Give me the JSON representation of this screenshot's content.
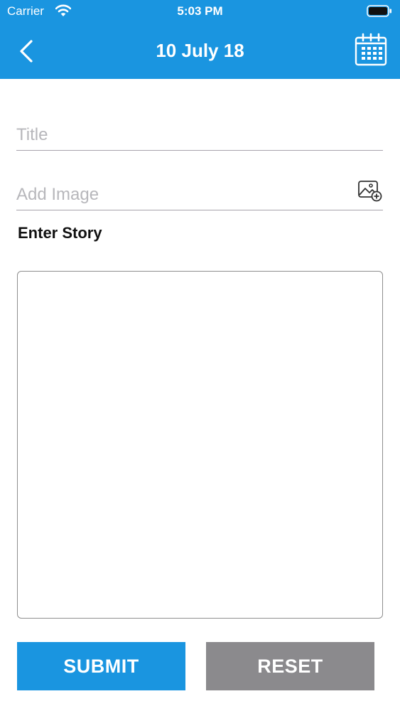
{
  "status_bar": {
    "carrier": "Carrier",
    "time": "5:03 PM"
  },
  "nav": {
    "title": "10 July 18",
    "back_icon": "chevron-left-icon",
    "calendar_icon": "calendar-icon"
  },
  "form": {
    "title_placeholder": "Title",
    "image_placeholder": "Add Image",
    "image_icon": "add-image-icon",
    "story_label": "Enter Story",
    "story_value": ""
  },
  "actions": {
    "submit_label": "SUBMIT",
    "reset_label": "RESET"
  },
  "colors": {
    "primary": "#1a95e0",
    "secondary_button": "#8b8a8d",
    "placeholder": "#b7b7bb",
    "divider": "#a7a2ac"
  }
}
